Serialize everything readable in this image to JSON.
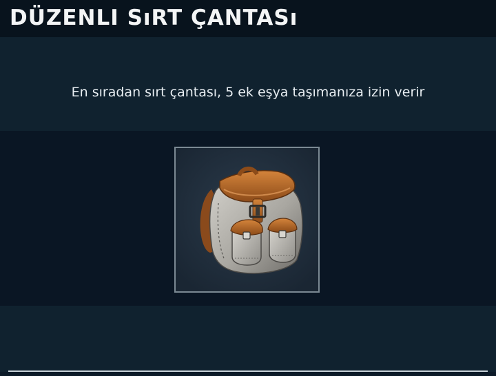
{
  "item": {
    "title": "DÜZENLI SıRT ÇANTASı",
    "description": "En sıradan sırt çantası, 5 ek eşya taşımanıza izin verir",
    "icon": "backpack-icon"
  },
  "colors": {
    "background": "#0c1a28",
    "title_bar": "#08131d",
    "band": "#10222f",
    "text": "#f3f5f6",
    "frame_border": "#7b8993",
    "leather": "#b56a2a",
    "canvas": "#b8b6b0"
  }
}
